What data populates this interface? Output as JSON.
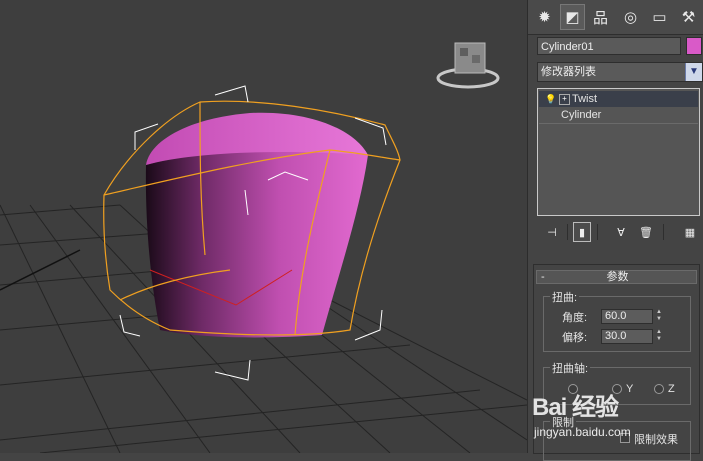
{
  "object": {
    "name": "Cylinder01",
    "color": "#d95ac8"
  },
  "modifier_list": {
    "label": "修改器列表"
  },
  "stack": [
    {
      "label": "Twist",
      "selected": true
    },
    {
      "label": "Cylinder",
      "selected": false
    }
  ],
  "rollout": {
    "collapse": "-",
    "title": "参数",
    "twist_group": "扭曲:",
    "angle_label": "角度:",
    "angle_value": "60.0",
    "bias_label": "偏移:",
    "bias_value": "30.0",
    "axis_group": "扭曲轴:",
    "axis_y": "Y",
    "axis_z": "Z",
    "limits_group": "限制",
    "limit_effect": "限制效果"
  },
  "watermark": {
    "brand": "Bai 经验",
    "url": "jingyan.baidu.com"
  },
  "icons": [
    "create-icon",
    "modify-icon",
    "hierarchy-icon",
    "motion-icon",
    "display-icon",
    "utilities-icon",
    "viewcube-icon"
  ],
  "colors": {
    "viewport_bg": "#3e3e3e",
    "panel_bg": "#444444",
    "gizmo": "#f0a020",
    "mesh": "#d458c0"
  }
}
